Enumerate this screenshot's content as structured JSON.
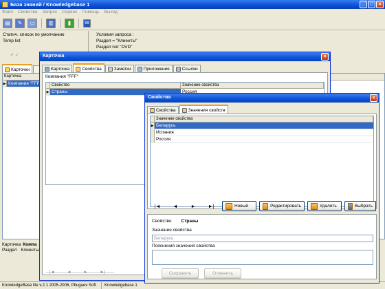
{
  "window": {
    "title": "База знаний / Knowledgebase 1"
  },
  "menu": [
    "Файл",
    "Свойства",
    "Запрос",
    "Сервис",
    "Помощь",
    "Выход"
  ],
  "filter": {
    "left_line1": "Статич. список по умолчанию",
    "left_line2": "Temp list",
    "right_title": "Условия запроса :",
    "cond1": "Раздел  = \"Клиенты\"",
    "cond2": "Раздел  not \"DVD\""
  },
  "main_tabs": {
    "cards": "Карточки"
  },
  "main_grid": {
    "header": "Карточка",
    "row1": "Компания \"FFF\""
  },
  "bottom_info": {
    "label1": "Карточка",
    "value1": "Компа",
    "label2": "Раздел",
    "value2": "Клиенты"
  },
  "statusbar": {
    "version": "KnowledgeBase lite v.2.1 2005-2006, Pbugaev Soft",
    "db": "Knowledgebase 1"
  },
  "card_dialog": {
    "title": "Карточка",
    "tabs": [
      "Карточка",
      "Свойства",
      "Заметки",
      "Приложения",
      "Ссылки"
    ],
    "company": "Компания \"FFF\"",
    "grid_headers": [
      "Свойство",
      "Значение свойства"
    ],
    "rows": [
      {
        "prop": "Страны",
        "value": "Россия"
      }
    ]
  },
  "props_dialog": {
    "title": "Свойства",
    "tabs": [
      "Свойства",
      "Значения свойств"
    ],
    "grid_header": "Значение свойства",
    "values": [
      "Беларусь",
      "Испания",
      "Россия"
    ],
    "buttons": {
      "new": "Новый",
      "edit": "Редактировать",
      "delete": "Удалить",
      "choose": "Выбрать"
    },
    "nav": [
      "|◄",
      "◄",
      "►",
      "►|"
    ],
    "property_label": "Свойство",
    "property_value": "Страны",
    "value_label": "Значение свойства",
    "value_field": "Беларусь",
    "explain_label": "Пояснения значения свойства",
    "save": "Сохранить",
    "cancel": "Отменить"
  },
  "colors": {
    "title_blue": "#0a50d8",
    "selection": "#316ac5",
    "xp_face": "#ece9d8"
  }
}
